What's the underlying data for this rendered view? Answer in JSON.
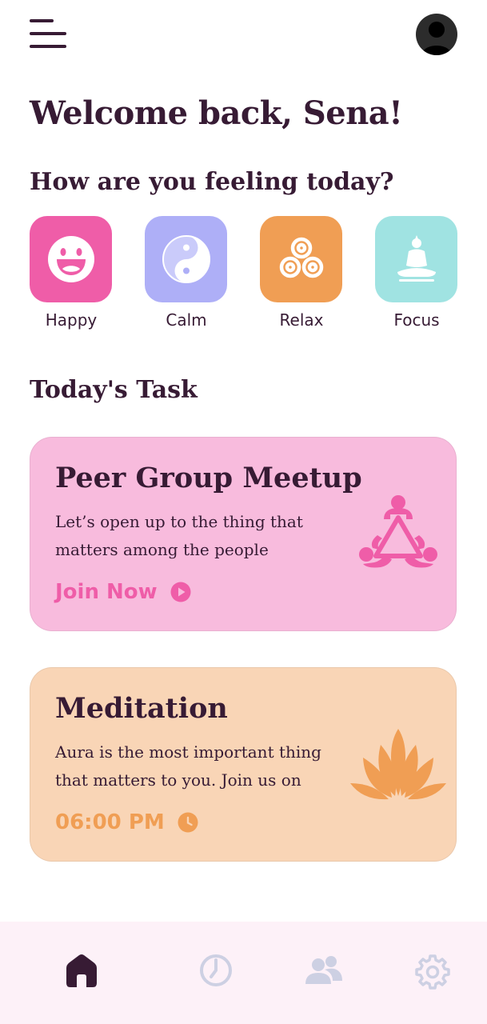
{
  "header": {
    "menu_icon": "menu-icon",
    "avatar_icon": "user-avatar-icon"
  },
  "greeting": {
    "prefix": "Welcome back, ",
    "name": "Sena!"
  },
  "prompt": "How are you feeling today?",
  "moods": [
    {
      "label": "Happy",
      "icon": "smiley-icon",
      "color": "#ef5da8"
    },
    {
      "label": "Calm",
      "icon": "yin-yang-icon",
      "color": "#aeaff7"
    },
    {
      "label": "Relax",
      "icon": "triskelion-icon",
      "color": "#f09e54"
    },
    {
      "label": "Focus",
      "icon": "meditating-figure-icon",
      "color": "#a0e3e2"
    }
  ],
  "tasks_title": "Today's Task",
  "tasks": [
    {
      "title": "Peer Group Meetup",
      "description": "Let’s open up to the thing that matters among the people",
      "action": "Join Now",
      "action_icon": "play-circle-icon",
      "icon": "group-meetup-icon",
      "background": "#f8bbdd",
      "accent": "#ef5da8"
    },
    {
      "title": "Meditation",
      "description": "Aura is the most important thing that matters to you. Join us on",
      "time": "06:00 PM",
      "time_icon": "clock-icon",
      "icon": "lotus-icon",
      "background": "#f9d5b6",
      "accent": "#f09e54"
    }
  ],
  "nav": [
    {
      "icon": "home-icon",
      "active": true
    },
    {
      "icon": "timer-icon",
      "active": false
    },
    {
      "icon": "community-icon",
      "active": false
    },
    {
      "icon": "settings-gear-icon",
      "active": false
    }
  ],
  "colors": {
    "text_primary": "#371b34",
    "nav_inactive": "#cdd0e3",
    "nav_background": "#fdf1f8"
  }
}
